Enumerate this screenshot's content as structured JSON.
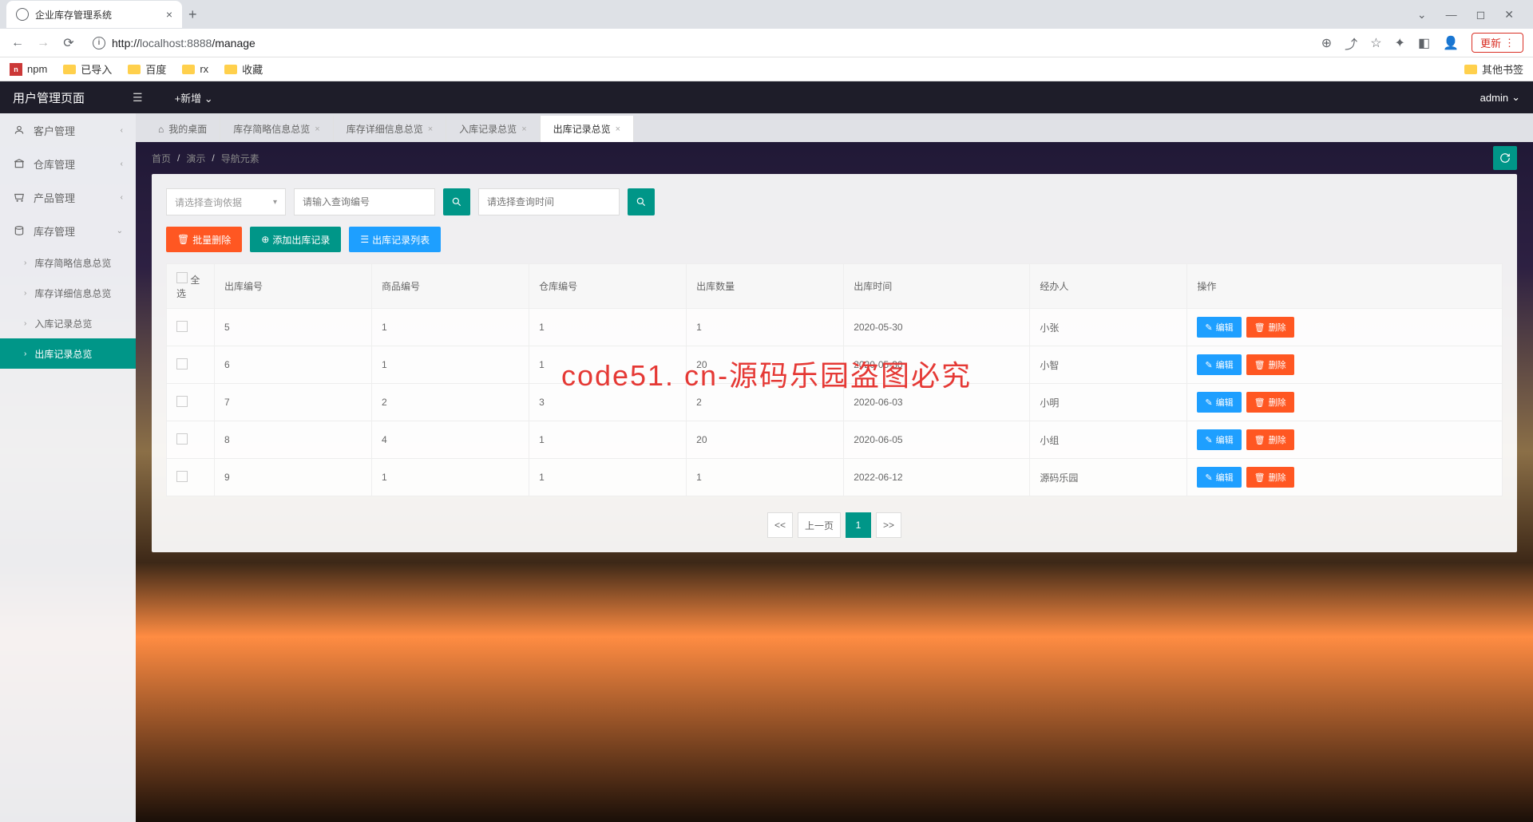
{
  "browser": {
    "tab_title": "企业库存管理系统",
    "url_prefix": "http://",
    "url_host": "localhost:8888",
    "url_path": "/manage",
    "update_label": "更新",
    "bookmarks": [
      "npm",
      "已导入",
      "百度",
      "rx",
      "收藏"
    ],
    "other_bookmarks": "其他书签"
  },
  "header": {
    "title": "用户管理页面",
    "add_new": "+新增",
    "user": "admin"
  },
  "sidebar": {
    "items": [
      {
        "label": "客户管理",
        "icon": "user"
      },
      {
        "label": "仓库管理",
        "icon": "warehouse"
      },
      {
        "label": "产品管理",
        "icon": "cart"
      },
      {
        "label": "库存管理",
        "icon": "database"
      }
    ],
    "subs": [
      {
        "label": "库存简略信息总览"
      },
      {
        "label": "库存详细信息总览"
      },
      {
        "label": "入库记录总览"
      },
      {
        "label": "出库记录总览"
      }
    ]
  },
  "tabs": [
    {
      "label": "我的桌面",
      "home": true
    },
    {
      "label": "库存简略信息总览"
    },
    {
      "label": "库存详细信息总览"
    },
    {
      "label": "入库记录总览"
    },
    {
      "label": "出库记录总览",
      "active": true
    }
  ],
  "breadcrumb": [
    "首页",
    "演示",
    "导航元素"
  ],
  "filters": {
    "select_placeholder": "请选择查询依据",
    "input_placeholder": "请输入查询编号",
    "date_placeholder": "请选择查询时间"
  },
  "actions": {
    "batch_delete": "批量删除",
    "add_record": "添加出库记录",
    "record_list": "出库记录列表"
  },
  "table": {
    "headers": [
      "全选",
      "出库编号",
      "商品编号",
      "仓库编号",
      "出库数量",
      "出库时间",
      "经办人",
      "操作"
    ],
    "edit_label": "编辑",
    "delete_label": "删除",
    "rows": [
      {
        "out_id": "5",
        "product_id": "1",
        "warehouse_id": "1",
        "qty": "1",
        "time": "2020-05-30",
        "handler": "小张"
      },
      {
        "out_id": "6",
        "product_id": "1",
        "warehouse_id": "1",
        "qty": "20",
        "time": "2020-05-30",
        "handler": "小智"
      },
      {
        "out_id": "7",
        "product_id": "2",
        "warehouse_id": "3",
        "qty": "2",
        "time": "2020-06-03",
        "handler": "小明"
      },
      {
        "out_id": "8",
        "product_id": "4",
        "warehouse_id": "1",
        "qty": "20",
        "time": "2020-06-05",
        "handler": "小组"
      },
      {
        "out_id": "9",
        "product_id": "1",
        "warehouse_id": "1",
        "qty": "1",
        "time": "2022-06-12",
        "handler": "源码乐园"
      }
    ]
  },
  "pagination": {
    "first": "<<",
    "prev": "上一页",
    "current": "1",
    "next": ">>"
  },
  "watermark": "code51. cn-源码乐园盗图必究"
}
